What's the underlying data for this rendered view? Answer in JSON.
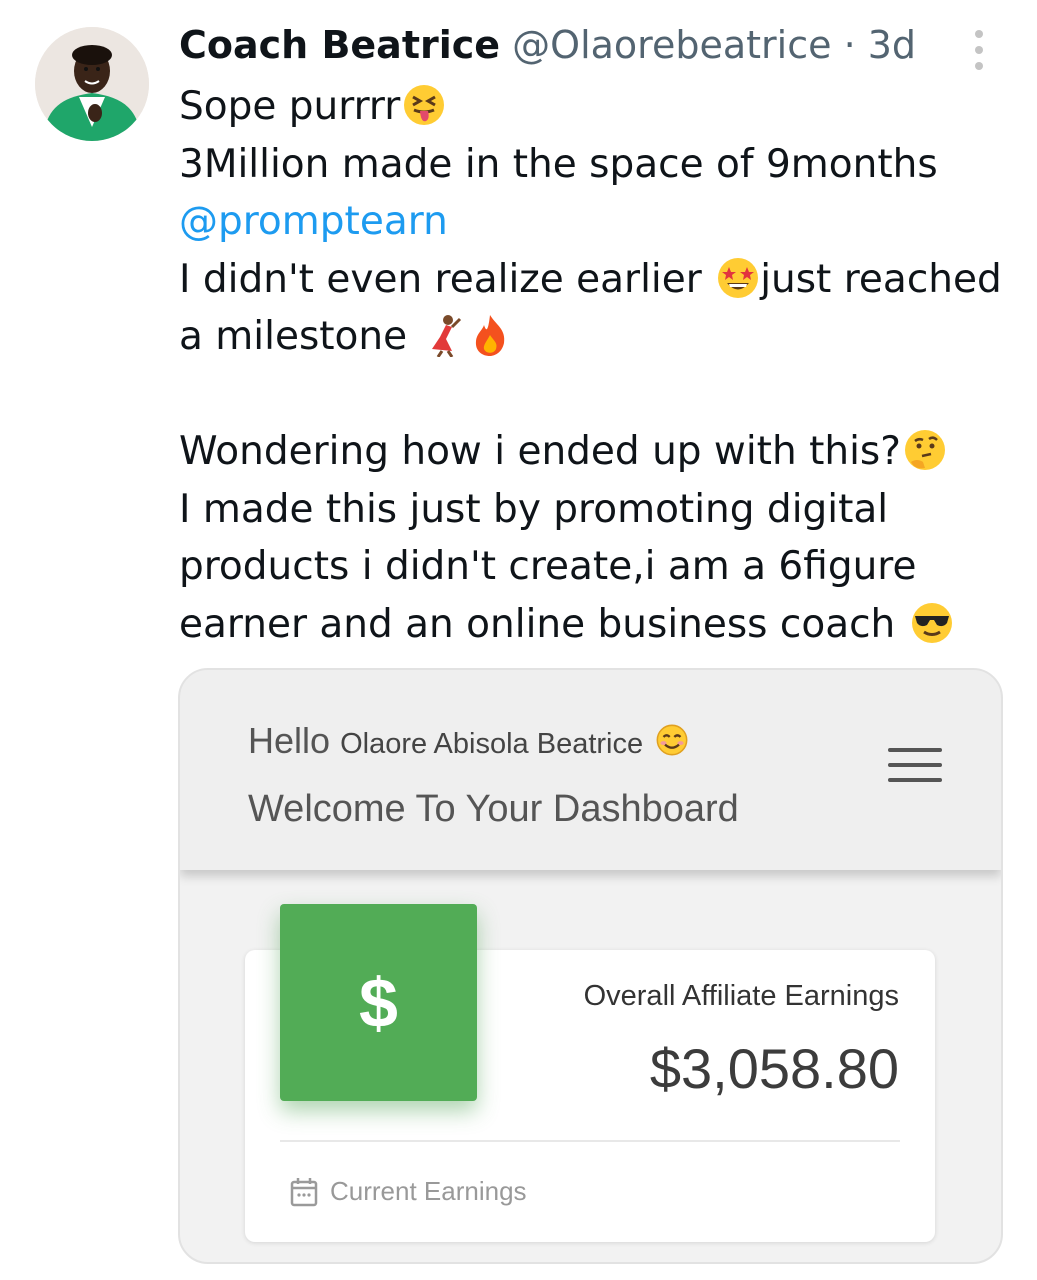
{
  "tweet": {
    "author_name": "Coach Beatrice",
    "author_handle": "@Olaorebeatrice",
    "separator": "·",
    "time": "3d",
    "more_icon": "more-vertical-icon",
    "avatar_icon": "profile-avatar"
  },
  "body": {
    "line1": "Sope purrrr",
    "line1_emoji": "squinting-tongue-emoji",
    "line2": "3Million made in the space of 9months",
    "mention": "@promptearn",
    "line4": "I didn't even realize earlier ",
    "line4_emoji": "star-struck-emoji",
    "line4_tail": "just reached",
    "line5": "a milestone ",
    "line5_emojis": [
      "dancer-emoji",
      "fire-emoji"
    ],
    "line7": "Wondering how i ended up with this?",
    "line7_emoji": "thinking-emoji",
    "line8": "I made this just by promoting digital",
    "line9": "products i didn't create,i am a 6figure",
    "line10": "earner and an online business coach ",
    "line10_emoji": "sunglasses-emoji"
  },
  "dashboard": {
    "hello": "Hello",
    "user_name": "Olaore Abisola Beatrice",
    "user_emoji": "smiling-emoji",
    "welcome": "Welcome To Your Dashboard",
    "menu_icon": "hamburger-menu-icon",
    "money_symbol": "$",
    "earnings_label": "Overall Affiliate Earnings",
    "earnings_value": "$3,058.80",
    "footer_icon": "calendar-icon",
    "footer_label": "Current Earnings",
    "colors": {
      "accent_green": "#52ac56",
      "mention_blue": "#1d9bf0",
      "secondary_text": "#536471"
    }
  }
}
